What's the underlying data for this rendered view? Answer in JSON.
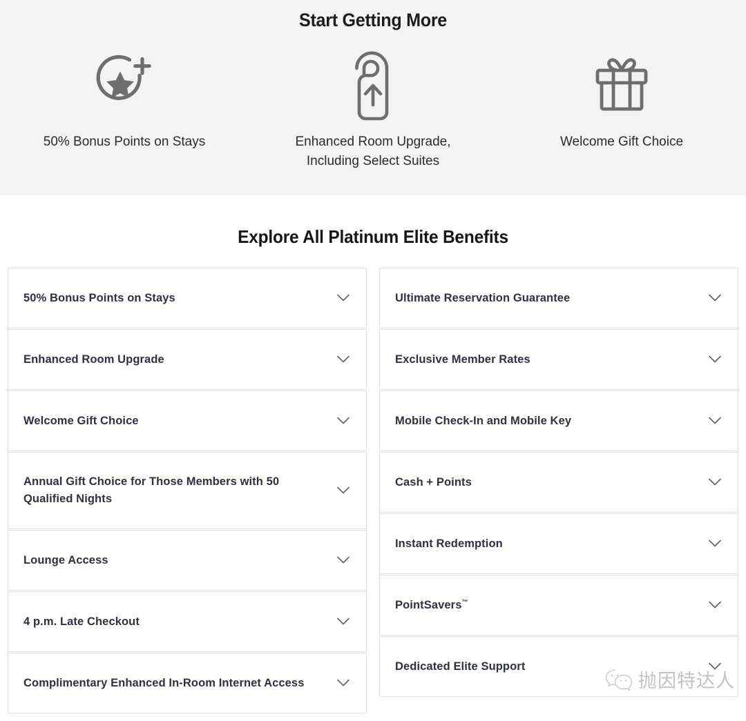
{
  "hero": {
    "title": "Start Getting More",
    "features": [
      {
        "icon": "star-plus-icon",
        "label": "50% Bonus Points on Stays"
      },
      {
        "icon": "door-hanger-upgrade-icon",
        "label": "Enhanced Room Upgrade,\nIncluding Select Suites"
      },
      {
        "icon": "gift-icon",
        "label": "Welcome Gift Choice"
      }
    ]
  },
  "benefits": {
    "title": "Explore All Platinum Elite Benefits",
    "chevron_icon": "chevron-down-icon",
    "left_column": [
      {
        "label": "50% Bonus Points on Stays",
        "tall": false
      },
      {
        "label": "Enhanced Room Upgrade",
        "tall": false
      },
      {
        "label": "Welcome Gift Choice",
        "tall": false
      },
      {
        "label": "Annual Gift Choice for Those Members with 50 Qualified Nights",
        "tall": true
      },
      {
        "label": "Lounge Access",
        "tall": false
      },
      {
        "label": "4 p.m. Late Checkout",
        "tall": false
      },
      {
        "label": "Complimentary Enhanced In-Room Internet Access",
        "tall": false
      }
    ],
    "right_column": [
      {
        "label": "Ultimate Reservation Guarantee",
        "tall": false
      },
      {
        "label": "Exclusive Member Rates",
        "tall": false
      },
      {
        "label": "Mobile Check-In and Mobile Key",
        "tall": false
      },
      {
        "label": "Cash + Points",
        "tall": false
      },
      {
        "label": "Instant Redemption",
        "tall": false
      },
      {
        "label": "PointSavers",
        "trademark": "™",
        "tall": false
      },
      {
        "label": "Dedicated Elite Support",
        "tall": false
      }
    ]
  },
  "watermark": {
    "icon": "wechat-icon",
    "text": "抛因特达人"
  },
  "colors": {
    "hero_background": "#f3f3f3",
    "icon_gray": "#6e6e6e",
    "heading": "#161616",
    "label": "#2d3142",
    "card_border": "#e2e2e2",
    "chevron": "#5a6475"
  }
}
